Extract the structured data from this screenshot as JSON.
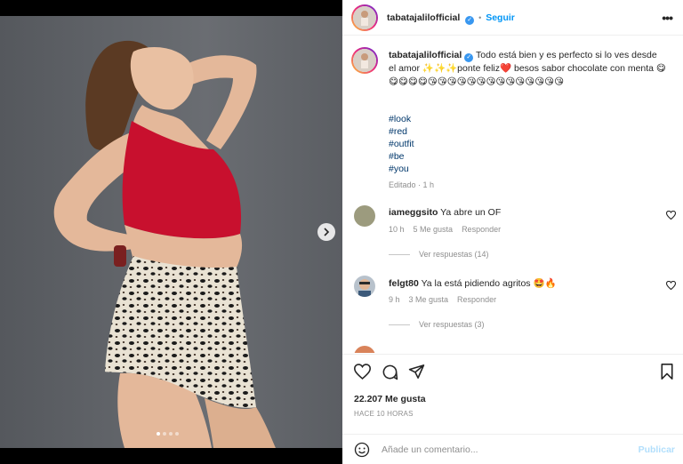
{
  "post": {
    "username": "tabatajalilofficial",
    "follow_label": "Seguir",
    "separator": "•",
    "caption": "Todo está bien y es perfecto si lo ves desde el amor ✨✨✨ponte feliz❤️ besos sabor chocolate con menta 😋😋😋😋😋😘😘😘😘😘😘😘😘😘😘😘😘😘😘",
    "hashtags": [
      "#look",
      "#red",
      "#outfit",
      "#be",
      "#you"
    ],
    "caption_meta": "Editado · 1 h",
    "likes": "22.207 Me gusta",
    "timestamp": "HACE 10 HORAS",
    "comment_placeholder": "Añade un comentario...",
    "publish_label": "Publicar"
  },
  "comments": [
    {
      "username": "iameggsito",
      "text": "Ya abre un OF",
      "time": "10 h",
      "likes": "5 Me gusta",
      "reply": "Responder",
      "view_replies": "Ver respuestas (14)"
    },
    {
      "username": "felgt80",
      "text": "Ya la está pidiendo agritos 🤩🔥",
      "time": "9 h",
      "likes": "3 Me gusta",
      "reply": "Responder",
      "view_replies": "Ver respuestas (3)"
    }
  ],
  "carousel": {
    "slides": 4,
    "current": 1
  },
  "colors": {
    "accent": "#0095f6",
    "top_color": "#c8102e",
    "wall": "#62656a"
  },
  "icons": [
    "heart-icon",
    "comment-icon",
    "share-icon",
    "bookmark-icon",
    "emoji-icon",
    "more-icon",
    "verified-icon",
    "chevron-right-icon"
  ]
}
